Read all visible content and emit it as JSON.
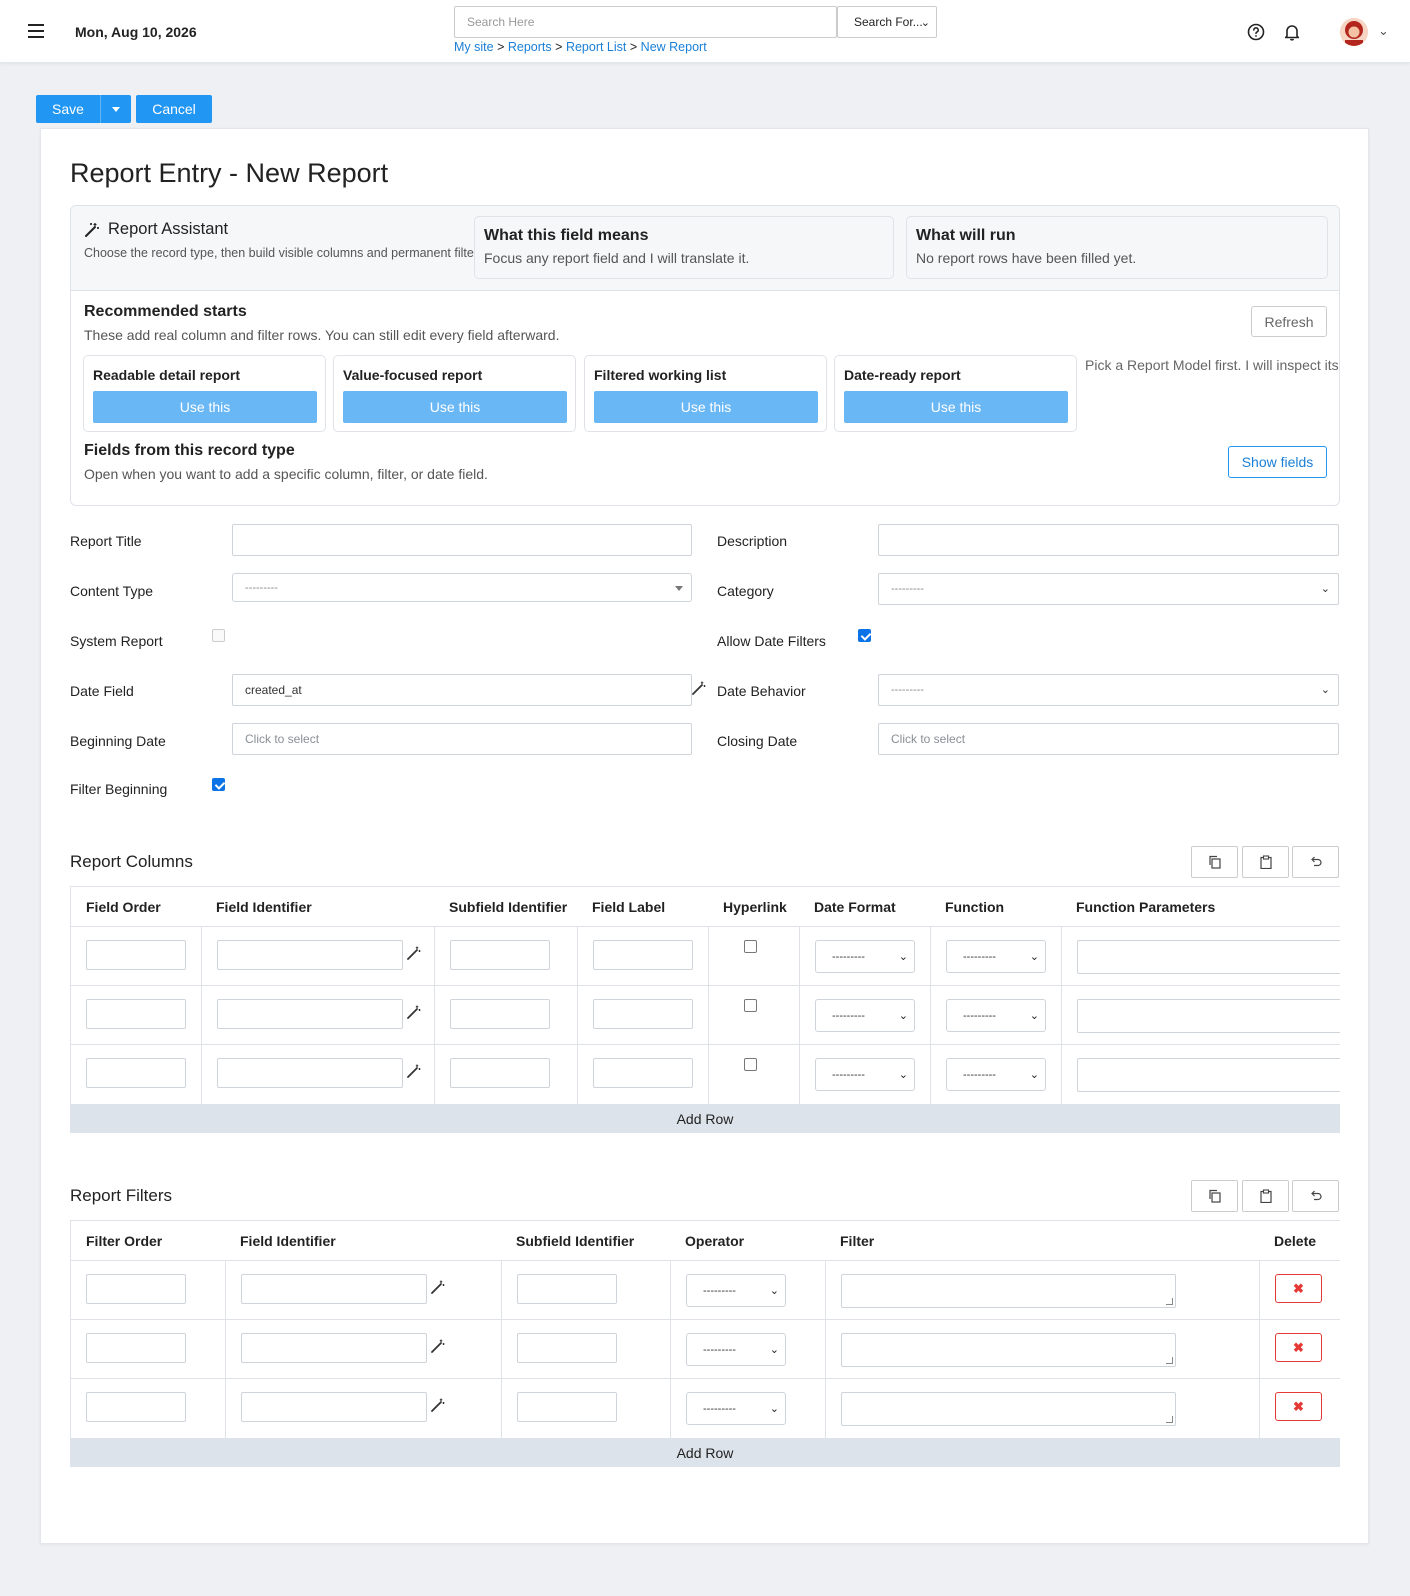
{
  "topbar": {
    "date": "Mon, Aug 10, 2026",
    "search_placeholder": "Search Here",
    "search_for": "Search For...",
    "breadcrumb": [
      "My site",
      "Reports",
      "Report List",
      "New Report"
    ],
    "sep": ">"
  },
  "actions": {
    "save": "Save",
    "cancel": "Cancel"
  },
  "page_title": "Report Entry - New Report",
  "assistant": {
    "title": "Report Assistant",
    "subtitle": "Choose the record type, then build visible columns and permanent filters.",
    "field_means_title": "What this field means",
    "field_means_text": "Focus any report field and I will translate it.",
    "will_run_title": "What will run",
    "will_run_text": "No report rows have been filled yet.",
    "recommended_title": "Recommended starts",
    "recommended_sub": "These add real column and filter rows. You can still edit every field afterward.",
    "refresh": "Refresh",
    "cards": [
      {
        "title": "Readable detail report",
        "button": "Use this"
      },
      {
        "title": "Value-focused report",
        "button": "Use this"
      },
      {
        "title": "Filtered working list",
        "button": "Use this"
      },
      {
        "title": "Date-ready report",
        "button": "Use this"
      }
    ],
    "pick_msg": "Pick a Report Model first. I will inspect its",
    "fields_title": "Fields from this record type",
    "fields_sub": "Open when you want to add a specific column, filter, or date field.",
    "show_fields": "Show fields"
  },
  "form": {
    "report_title": "Report Title",
    "description": "Description",
    "content_type": "Content Type",
    "content_type_value": "---------",
    "category": "Category",
    "category_value": "---------",
    "system_report": "System Report",
    "system_report_checked": false,
    "allow_date_filters": "Allow Date Filters",
    "allow_date_filters_checked": true,
    "date_field": "Date Field",
    "date_field_value": "created_at",
    "date_behavior": "Date Behavior",
    "date_behavior_value": "---------",
    "beginning_date": "Beginning Date",
    "closing_date": "Closing Date",
    "date_placeholder": "Click to select",
    "filter_beginning": "Filter Beginning",
    "filter_beginning_checked": true
  },
  "columns": {
    "title": "Report Columns",
    "headers": [
      "Field Order",
      "Field Identifier",
      "Subfield Identifier",
      "Field Label",
      "Hyperlink",
      "Date Format",
      "Function",
      "Function Parameters"
    ],
    "select_placeholder": "---------",
    "add_row": "Add Row"
  },
  "filters": {
    "title": "Report Filters",
    "headers": [
      "Filter Order",
      "Field Identifier",
      "Subfield Identifier",
      "Operator",
      "Filter",
      "Delete"
    ],
    "select_placeholder": "---------",
    "delete_symbol": "✖",
    "add_row": "Add Row"
  },
  "icons": [
    "menu-icon",
    "help-icon",
    "bell-icon",
    "wand-icon",
    "copy-icon",
    "paste-icon",
    "undo-icon",
    "close-icon",
    "chevron-down-icon"
  ],
  "colors": {
    "primary": "#2196f3",
    "link": "#1a7fd6",
    "danger": "#e53935",
    "accent_light": "#6ab7f5"
  }
}
